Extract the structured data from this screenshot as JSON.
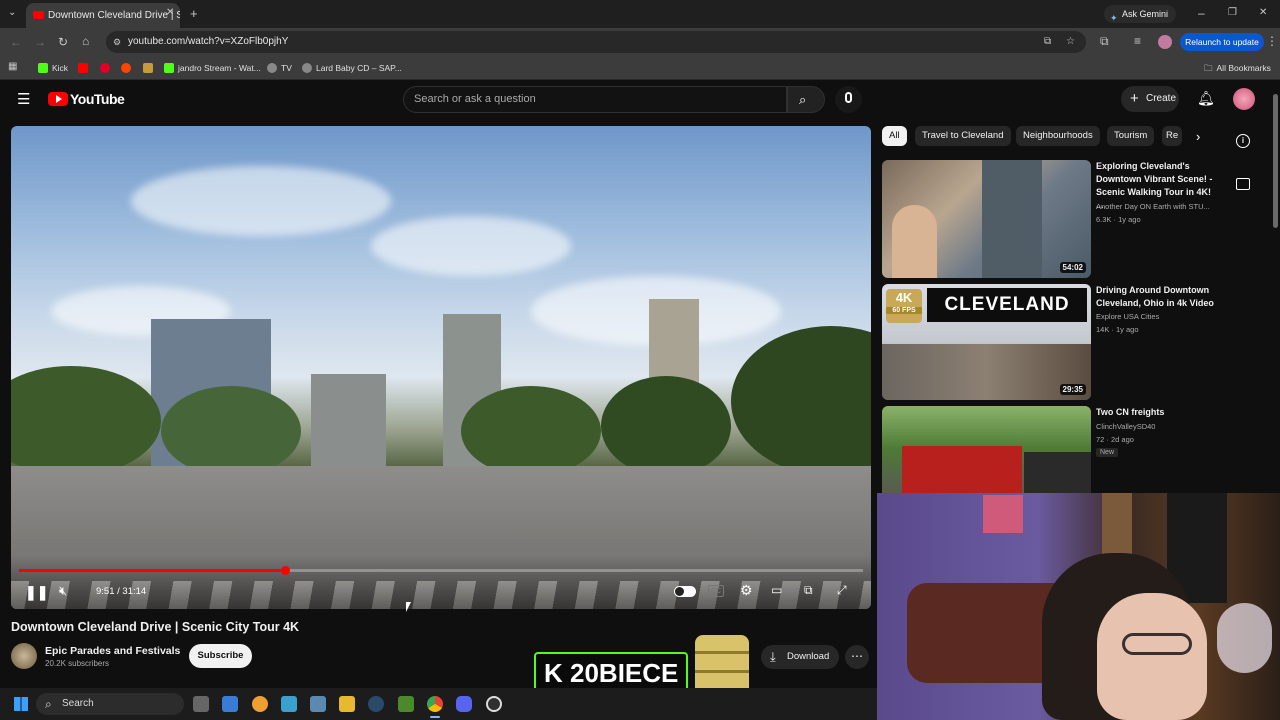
{
  "browser": {
    "tab_title": "Downtown Cleveland Drive | Sc",
    "url": "youtube.com/watch?v=XZoFlb0pjhY",
    "ask_gemini": "Ask Gemini",
    "relaunch": "Relaunch to update",
    "bookmarks": [
      "Kick",
      "jandro Stream - Wat...",
      "TV",
      "Lard Baby CD – SAP..."
    ],
    "all_bookmarks": "All Bookmarks"
  },
  "youtube": {
    "logo": "YouTube",
    "search_placeholder": "Search or ask a question",
    "create": "Create"
  },
  "player": {
    "time": "9:51 / 31:14",
    "progress": 0.315
  },
  "video": {
    "title": "Downtown Cleveland Drive | Scenic City Tour 4K",
    "channel": "Epic Parades and Festivals",
    "subscribers": "20.2K subscribers",
    "subscribe": "Subscribe",
    "download": "Download"
  },
  "chips": [
    "All",
    "Travel to Cleveland",
    "Neighbourhoods",
    "Tourism",
    "Re"
  ],
  "recommendations": [
    {
      "title": "Exploring Cleveland's Downtown Vibrant Scene! - Scenic Walking Tour in 4K! ...",
      "channel": "Another Day ON Earth with STU...",
      "meta": "6.3K · 1y ago",
      "duration": "54:02",
      "thumb_text": ""
    },
    {
      "title": "Driving Around Downtown Cleveland, Ohio in 4k Video",
      "channel": "Explore USA Cities",
      "meta": "14K · 1y ago",
      "duration": "29:35",
      "thumb_text": "CLEVELAND",
      "badge": "4K",
      "badge_sub": "60 FPS"
    },
    {
      "title": "Two CN freights",
      "channel": "ClinchValleySD40",
      "meta": "72 · 2d ago",
      "duration": "",
      "thumb_text": "",
      "new_badge": "New"
    }
  ],
  "overlay": {
    "stream_tag": "K 20BIECE"
  },
  "taskbar": {
    "search": "Search"
  },
  "colors": {
    "accent_red": "#ff0000",
    "relaunch_blue": "#0b57d0",
    "kick_green": "#53fc18"
  }
}
